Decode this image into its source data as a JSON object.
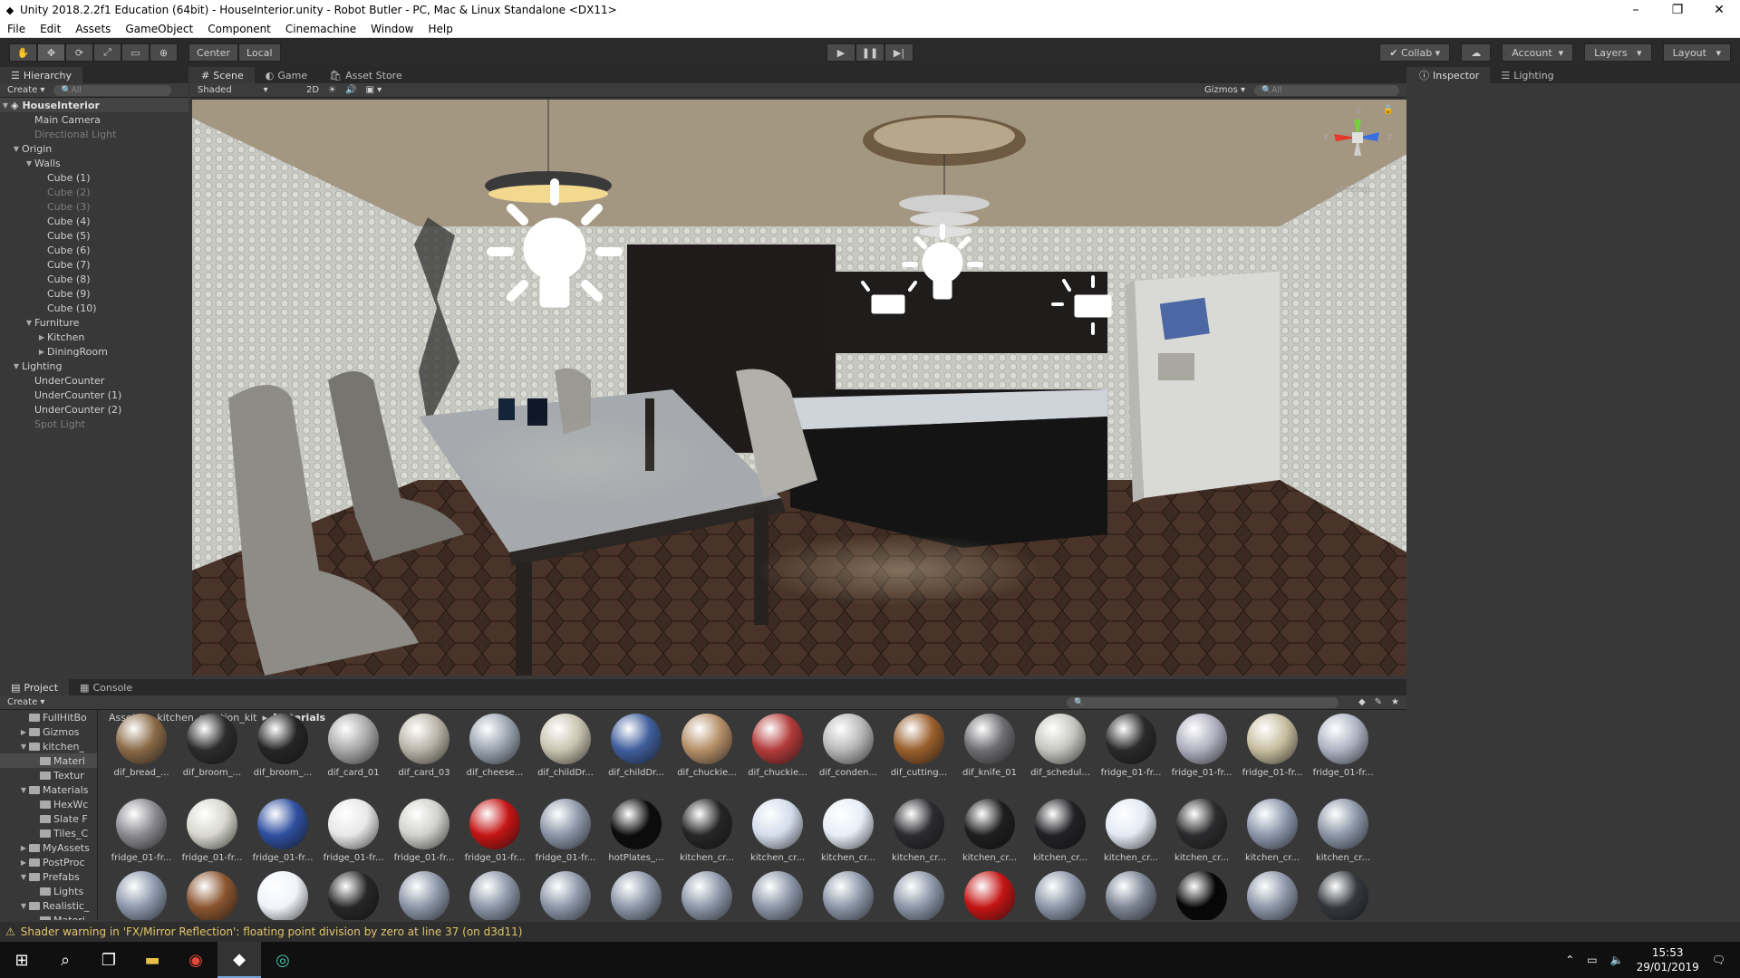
{
  "window": {
    "title": "Unity 2018.2.2f1 Education (64bit) - HouseInterior.unity - Robot Butler - PC, Mac & Linux Standalone <DX11>"
  },
  "menu": [
    "File",
    "Edit",
    "Assets",
    "GameObject",
    "Component",
    "Cinemachine",
    "Window",
    "Help"
  ],
  "toolbar": {
    "pivot": "Center",
    "space": "Local",
    "collab": "Collab",
    "account": "Account",
    "layers": "Layers",
    "layout": "Layout"
  },
  "hierarchy": {
    "tab": "Hierarchy",
    "create": "Create",
    "search_placeholder": "All",
    "scene_name": "HouseInterior",
    "items": [
      {
        "label": "Main Camera",
        "indent": 1,
        "arrow": "",
        "dim": false
      },
      {
        "label": "Directional Light",
        "indent": 1,
        "arrow": "",
        "dim": true
      },
      {
        "label": "Origin",
        "indent": 0,
        "arrow": "down",
        "dim": false
      },
      {
        "label": "Walls",
        "indent": 1,
        "arrow": "down",
        "dim": false
      },
      {
        "label": "Cube (1)",
        "indent": 2,
        "arrow": "",
        "dim": false
      },
      {
        "label": "Cube (2)",
        "indent": 2,
        "arrow": "",
        "dim": true
      },
      {
        "label": "Cube (3)",
        "indent": 2,
        "arrow": "",
        "dim": true
      },
      {
        "label": "Cube (4)",
        "indent": 2,
        "arrow": "",
        "dim": false
      },
      {
        "label": "Cube (5)",
        "indent": 2,
        "arrow": "",
        "dim": false
      },
      {
        "label": "Cube (6)",
        "indent": 2,
        "arrow": "",
        "dim": false
      },
      {
        "label": "Cube (7)",
        "indent": 2,
        "arrow": "",
        "dim": false
      },
      {
        "label": "Cube (8)",
        "indent": 2,
        "arrow": "",
        "dim": false
      },
      {
        "label": "Cube (9)",
        "indent": 2,
        "arrow": "",
        "dim": false
      },
      {
        "label": "Cube (10)",
        "indent": 2,
        "arrow": "",
        "dim": false
      },
      {
        "label": "Furniture",
        "indent": 1,
        "arrow": "down",
        "dim": false
      },
      {
        "label": "Kitchen",
        "indent": 2,
        "arrow": "right",
        "dim": false
      },
      {
        "label": "DiningRoom",
        "indent": 2,
        "arrow": "right",
        "dim": false
      },
      {
        "label": "Lighting",
        "indent": 0,
        "arrow": "down",
        "dim": false
      },
      {
        "label": "UnderCounter",
        "indent": 1,
        "arrow": "",
        "dim": false
      },
      {
        "label": "UnderCounter (1)",
        "indent": 1,
        "arrow": "",
        "dim": false
      },
      {
        "label": "UnderCounter (2)",
        "indent": 1,
        "arrow": "",
        "dim": false
      },
      {
        "label": "Spot Light",
        "indent": 1,
        "arrow": "",
        "dim": true
      }
    ]
  },
  "scene_view": {
    "tabs": [
      "Scene",
      "Game",
      "Asset Store"
    ],
    "shading": "Shaded",
    "mode_2d": "2D",
    "gizmos": "Gizmos",
    "search_placeholder": "All",
    "axes": {
      "x": "x",
      "y": "y",
      "z": "z"
    },
    "projection": "Persp"
  },
  "inspector": {
    "tabs": [
      "Inspector",
      "Lighting"
    ]
  },
  "project": {
    "tabs": [
      "Project",
      "Console"
    ],
    "create": "Create",
    "breadcrumb": [
      "Assets",
      "kitchen_creation_kit",
      "Materials"
    ],
    "tree": [
      {
        "label": "FullHitBo",
        "indent": 1,
        "arrow": ""
      },
      {
        "label": "Gizmos",
        "indent": 1,
        "arrow": "right"
      },
      {
        "label": "kitchen_",
        "indent": 1,
        "arrow": "down"
      },
      {
        "label": "Materi",
        "indent": 2,
        "arrow": "",
        "sel": true
      },
      {
        "label": "Textur",
        "indent": 2,
        "arrow": ""
      },
      {
        "label": "Materials",
        "indent": 1,
        "arrow": "down"
      },
      {
        "label": "HexWc",
        "indent": 2,
        "arrow": ""
      },
      {
        "label": "Slate F",
        "indent": 2,
        "arrow": ""
      },
      {
        "label": "Tiles_C",
        "indent": 2,
        "arrow": ""
      },
      {
        "label": "MyAssets",
        "indent": 1,
        "arrow": "right"
      },
      {
        "label": "PostProc",
        "indent": 1,
        "arrow": "right"
      },
      {
        "label": "Prefabs",
        "indent": 1,
        "arrow": "down"
      },
      {
        "label": "Lights",
        "indent": 2,
        "arrow": ""
      },
      {
        "label": "Realistic_",
        "indent": 1,
        "arrow": "down"
      },
      {
        "label": "Materi",
        "indent": 2,
        "arrow": ""
      }
    ],
    "rows": [
      [
        {
          "name": "dif_bread_...",
          "color": "#8a6a48"
        },
        {
          "name": "dif_broom_...",
          "color": "#2c2c2c"
        },
        {
          "name": "dif_broom_...",
          "color": "#252525"
        },
        {
          "name": "dif_card_01",
          "color": "#a9a9a9"
        },
        {
          "name": "dif_card_03",
          "color": "#b9b4a8"
        },
        {
          "name": "dif_cheese...",
          "color": "#9aa4b0"
        },
        {
          "name": "dif_childDr...",
          "color": "#c9c4b0"
        },
        {
          "name": "dif_childDr...",
          "color": "#3f5e9c"
        },
        {
          "name": "dif_chuckie...",
          "color": "#b58f68"
        },
        {
          "name": "dif_chuckie...",
          "color": "#b33a3a"
        },
        {
          "name": "dif_conden...",
          "color": "#b8b8b8"
        },
        {
          "name": "dif_cutting...",
          "color": "#9a5f2c"
        },
        {
          "name": "dif_knife_01",
          "color": "#6e6e72"
        },
        {
          "name": "dif_schedul...",
          "color": "#c5c5c0"
        },
        {
          "name": "fridge_01-fr...",
          "color": "#2a2a2a"
        },
        {
          "name": "fridge_01-fr...",
          "color": "#b0b0c0"
        },
        {
          "name": "fridge_01-fr...",
          "color": "#c7bea0"
        },
        {
          "name": "fridge_01-fr...",
          "color": "#aeb4c4"
        }
      ],
      [
        {
          "name": "fridge_01-fr...",
          "color": "#8a8a90"
        },
        {
          "name": "fridge_01-fr...",
          "color": "#d8d8d0"
        },
        {
          "name": "fridge_01-fr...",
          "color": "#2f4fa0"
        },
        {
          "name": "fridge_01-fr...",
          "color": "#e8e8e8"
        },
        {
          "name": "fridge_01-fr...",
          "color": "#d0d0cc"
        },
        {
          "name": "fridge_01-fr...",
          "color": "#c41414"
        },
        {
          "name": "fridge_01-fr...",
          "color": "#8c96a8"
        },
        {
          "name": "hotPlates_...",
          "color": "#0c0c0c"
        },
        {
          "name": "kitchen_cr...",
          "color": "#262626"
        },
        {
          "name": "kitchen_cr...",
          "color": "#d4dcec"
        },
        {
          "name": "kitchen_cr...",
          "color": "#e8eef8"
        },
        {
          "name": "kitchen_cr...",
          "color": "#2c2c30"
        },
        {
          "name": "kitchen_cr...",
          "color": "#1e1e1e"
        },
        {
          "name": "kitchen_cr...",
          "color": "#222226"
        },
        {
          "name": "kitchen_cr...",
          "color": "#e4eaf4"
        },
        {
          "name": "kitchen_cr...",
          "color": "#2c2c2e"
        },
        {
          "name": "kitchen_cr...",
          "color": "#8c98ac"
        },
        {
          "name": "kitchen_cr...",
          "color": "#8c96a8"
        }
      ],
      [
        {
          "name": "",
          "color": "#8c98ac"
        },
        {
          "name": "",
          "color": "#8a5530"
        },
        {
          "name": "",
          "color": "#f0f4fa"
        },
        {
          "name": "",
          "color": "#262626"
        },
        {
          "name": "",
          "color": "#8c96a8"
        },
        {
          "name": "",
          "color": "#8c96a8"
        },
        {
          "name": "",
          "color": "#8c96a8"
        },
        {
          "name": "",
          "color": "#8c96a8"
        },
        {
          "name": "",
          "color": "#8c96a8"
        },
        {
          "name": "",
          "color": "#8c96a8"
        },
        {
          "name": "",
          "color": "#8c96a8"
        },
        {
          "name": "",
          "color": "#8c96a8"
        },
        {
          "name": "",
          "color": "#c41414"
        },
        {
          "name": "",
          "color": "#8c96a8"
        },
        {
          "name": "",
          "color": "#7c8494"
        },
        {
          "name": "",
          "color": "#060606"
        },
        {
          "name": "",
          "color": "#8c96a8"
        },
        {
          "name": "",
          "color": "#34383e"
        }
      ]
    ]
  },
  "status": {
    "message": "Shader warning in 'FX/Mirror Reflection': floating point division by zero at line 37 (on d3d11)"
  },
  "taskbar": {
    "time": "15:53",
    "date": "29/01/2019"
  },
  "colors": {
    "accent": "#e2c66b",
    "panel": "#383838",
    "toolbar": "#2a2a2a"
  }
}
